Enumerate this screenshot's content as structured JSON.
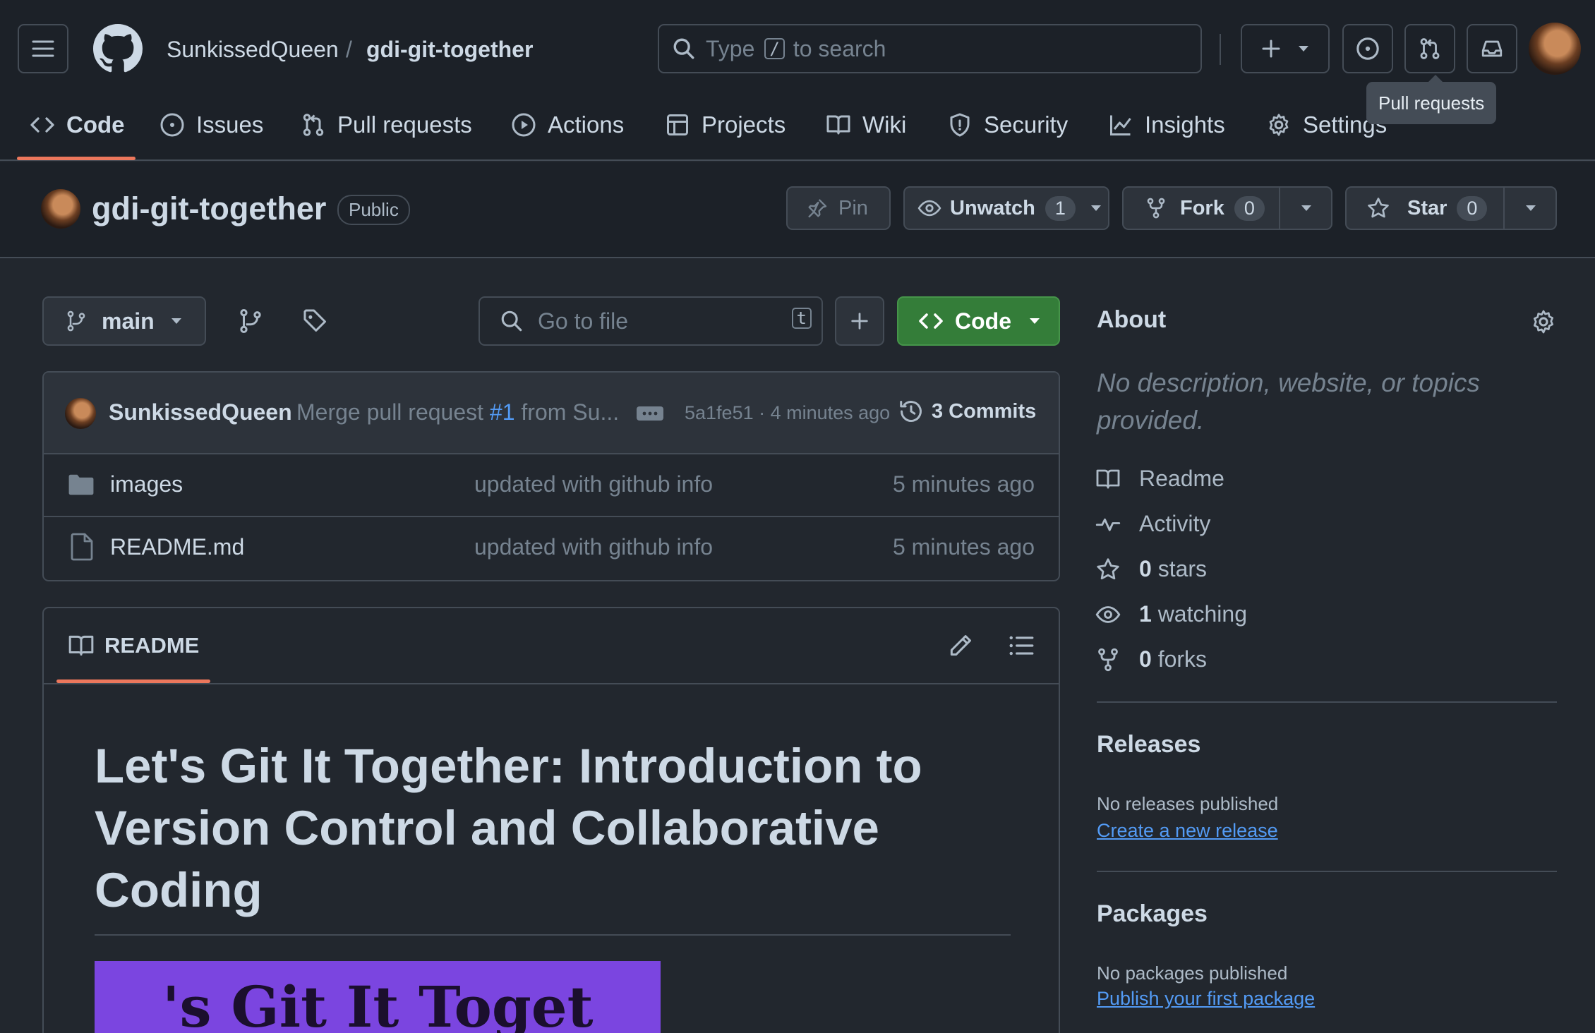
{
  "header": {
    "owner": "SunkissedQueen",
    "separator": "/",
    "repo": "gdi-git-together",
    "search": {
      "prefix": "Type",
      "key": "/",
      "suffix": "to search"
    },
    "tooltip": "Pull requests"
  },
  "tabs": [
    {
      "label": "Code"
    },
    {
      "label": "Issues"
    },
    {
      "label": "Pull requests"
    },
    {
      "label": "Actions"
    },
    {
      "label": "Projects"
    },
    {
      "label": "Wiki"
    },
    {
      "label": "Security"
    },
    {
      "label": "Insights"
    },
    {
      "label": "Settings"
    }
  ],
  "repohead": {
    "name": "gdi-git-together",
    "visibility": "Public",
    "pin": "Pin",
    "unwatch": "Unwatch",
    "watch_count": "1",
    "fork": "Fork",
    "fork_count": "0",
    "star": "Star",
    "star_count": "0"
  },
  "toolbar": {
    "branch": "main",
    "go_to_file": "Go to file",
    "go_to_file_key": "t",
    "code_button": "Code"
  },
  "commit": {
    "author": "SunkissedQueen",
    "message_prefix": "Merge pull request",
    "pr": "#1",
    "message_suffix": "from Su...",
    "sha_time": "5a1fe51 · 4 minutes ago",
    "commits": "3 Commits"
  },
  "files": [
    {
      "name": "images",
      "type": "folder",
      "message": "updated with github info",
      "time": "5 minutes ago"
    },
    {
      "name": "README.md",
      "type": "file",
      "message": "updated with github info",
      "time": "5 minutes ago"
    }
  ],
  "readme": {
    "tab": "README",
    "heading_lines": [
      "Let's Git It Together: Introduction to",
      "Version Control and Collaborative",
      "Coding"
    ],
    "banner_text": "'s Git It Toget",
    "banner_color": "#7b45e0"
  },
  "about": {
    "title": "About",
    "description": "No description, website, or topics provided.",
    "items": [
      {
        "label": "Readme",
        "icon": "book-icon"
      },
      {
        "label": "Activity",
        "icon": "pulse-icon"
      },
      {
        "count": "0",
        "label": "stars",
        "icon": "star-icon"
      },
      {
        "count": "1",
        "label": "watching",
        "icon": "eye-icon"
      },
      {
        "count": "0",
        "label": "forks",
        "icon": "fork-icon"
      }
    ]
  },
  "releases": {
    "title": "Releases",
    "empty": "No releases published",
    "link": "Create a new release"
  },
  "packages": {
    "title": "Packages",
    "empty": "No packages published",
    "link": "Publish your first package"
  },
  "colors": {
    "accent_green": "#347d39",
    "link_blue": "#539bf5",
    "tab_underline": "#ec775c"
  }
}
